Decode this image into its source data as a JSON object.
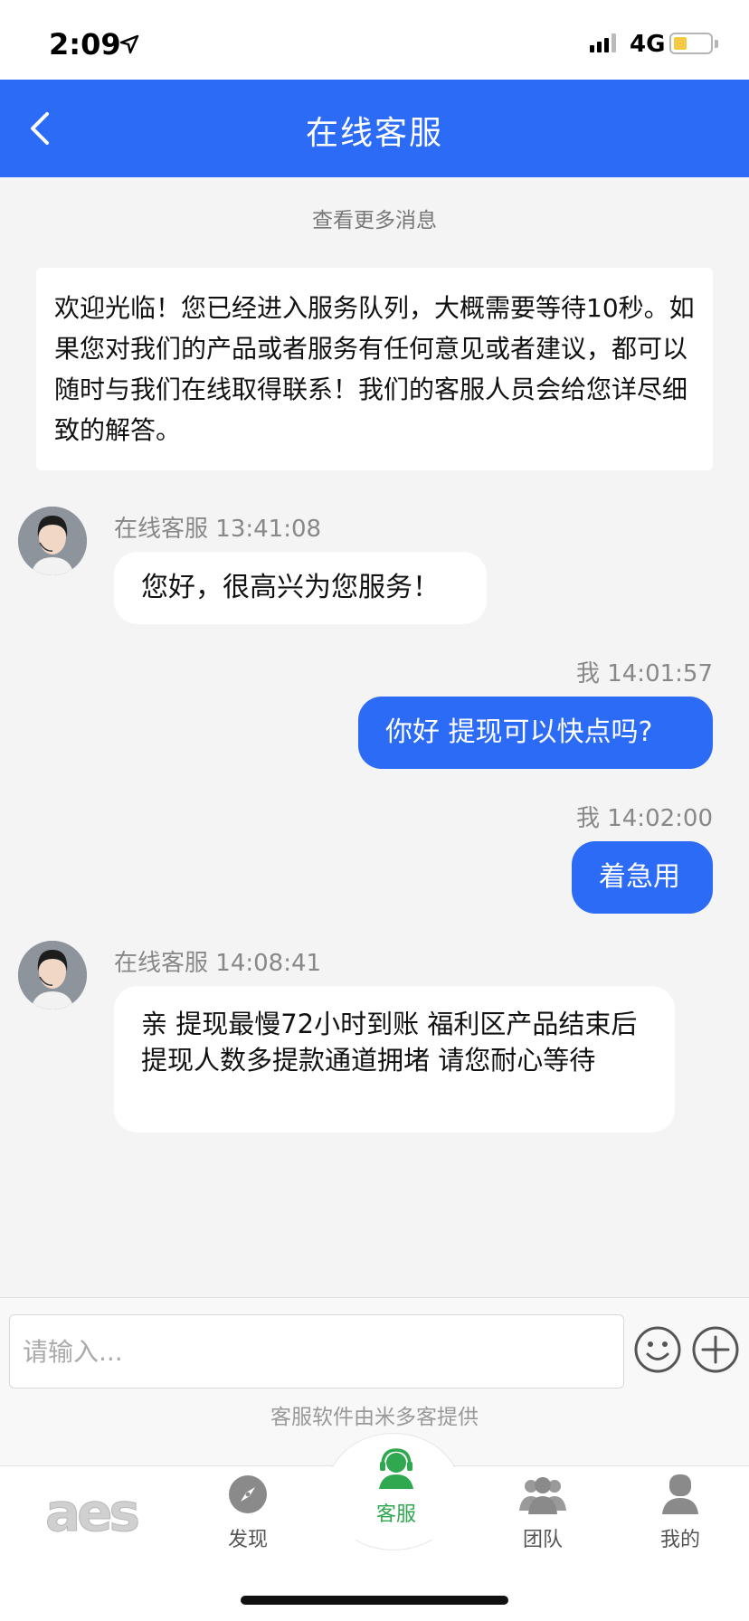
{
  "status_bar": {
    "time": "2:09",
    "network": "4G"
  },
  "header": {
    "title": "在线客服"
  },
  "more_messages": "查看更多消息",
  "welcome_text": "欢迎光临！您已经进入服务队列，大概需要等待10秒。如果您对我们的产品或者服务有任何意见或者建议，都可以随时与我们在线取得联系！我们的客服人员会给您详尽细致的解答。",
  "messages": [
    {
      "sender": "在线客服",
      "time": "13:41:08",
      "text": "您好，很高兴为您服务！"
    },
    {
      "sender": "我",
      "time": "14:01:57",
      "text": "你好 提现可以快点吗?"
    },
    {
      "sender": "我",
      "time": "14:02:00",
      "text": "着急用"
    },
    {
      "sender": "在线客服",
      "time": "14:08:41",
      "text": "亲  提现最慢72小时到账  福利区产品结束后提现人数多提款通道拥堵  请您耐心等待"
    }
  ],
  "input": {
    "placeholder": "请输入..."
  },
  "powered_by": "客服软件由米多客提供",
  "tabbar": {
    "logo": "aes",
    "items": [
      {
        "label": "发现",
        "icon": "compass-icon"
      },
      {
        "label": "客服",
        "icon": "headset-agent-icon",
        "active": true
      },
      {
        "label": "团队",
        "icon": "team-icon"
      },
      {
        "label": "我的",
        "icon": "profile-icon"
      }
    ]
  },
  "colors": {
    "primary": "#2c6bf5",
    "active_tab": "#2fa84f",
    "background": "#f4f4f4"
  }
}
